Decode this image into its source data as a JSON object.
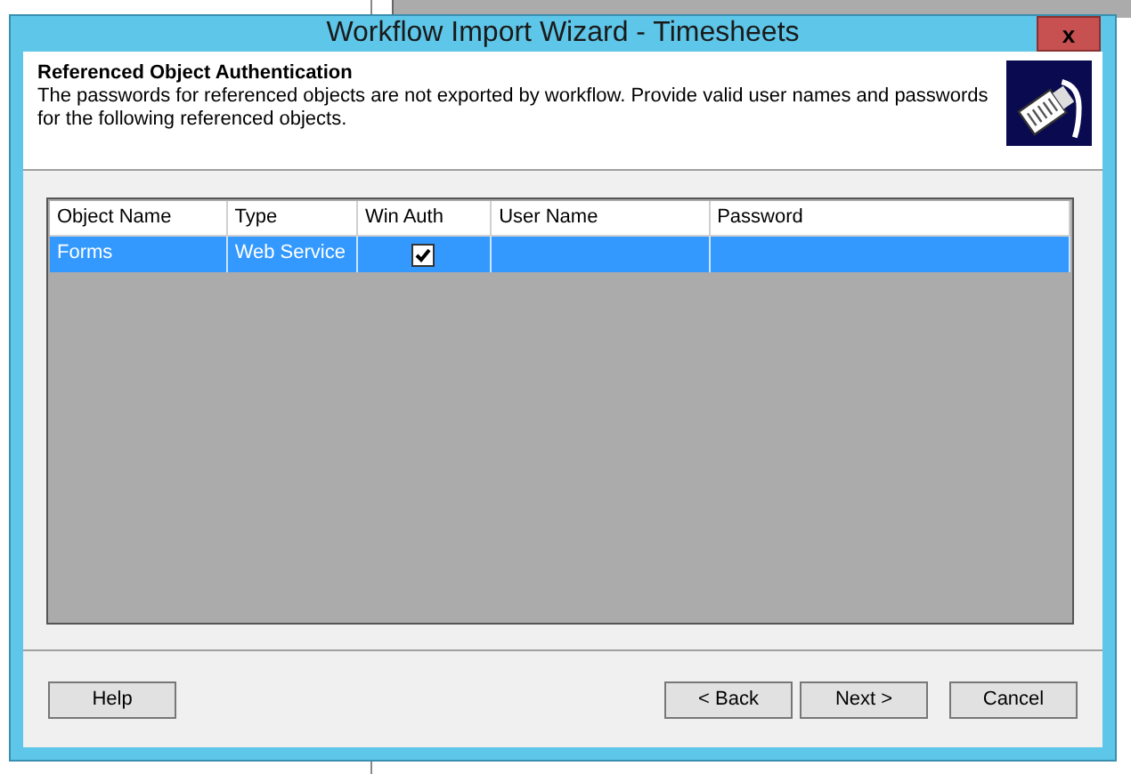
{
  "window": {
    "title": "Workflow Import Wizard - Timesheets",
    "close": "x"
  },
  "header": {
    "title": "Referenced Object Authentication",
    "description": "The passwords for referenced objects are not exported by workflow. Provide valid user names and passwords for the following referenced objects."
  },
  "table": {
    "columns": [
      "Object Name",
      "Type",
      "Win Auth",
      "User Name",
      "Password"
    ],
    "rows": [
      {
        "object_name": "Forms",
        "type": "Web Service",
        "win_auth": true,
        "user_name": "",
        "password": "",
        "selected": true
      }
    ]
  },
  "buttons": [
    {
      "label": "Help",
      "kind": "left"
    },
    {
      "label": "< Back",
      "kind": "right"
    },
    {
      "label": "Next >",
      "kind": "right"
    },
    {
      "label": "Cancel",
      "kind": "cancel"
    }
  ]
}
